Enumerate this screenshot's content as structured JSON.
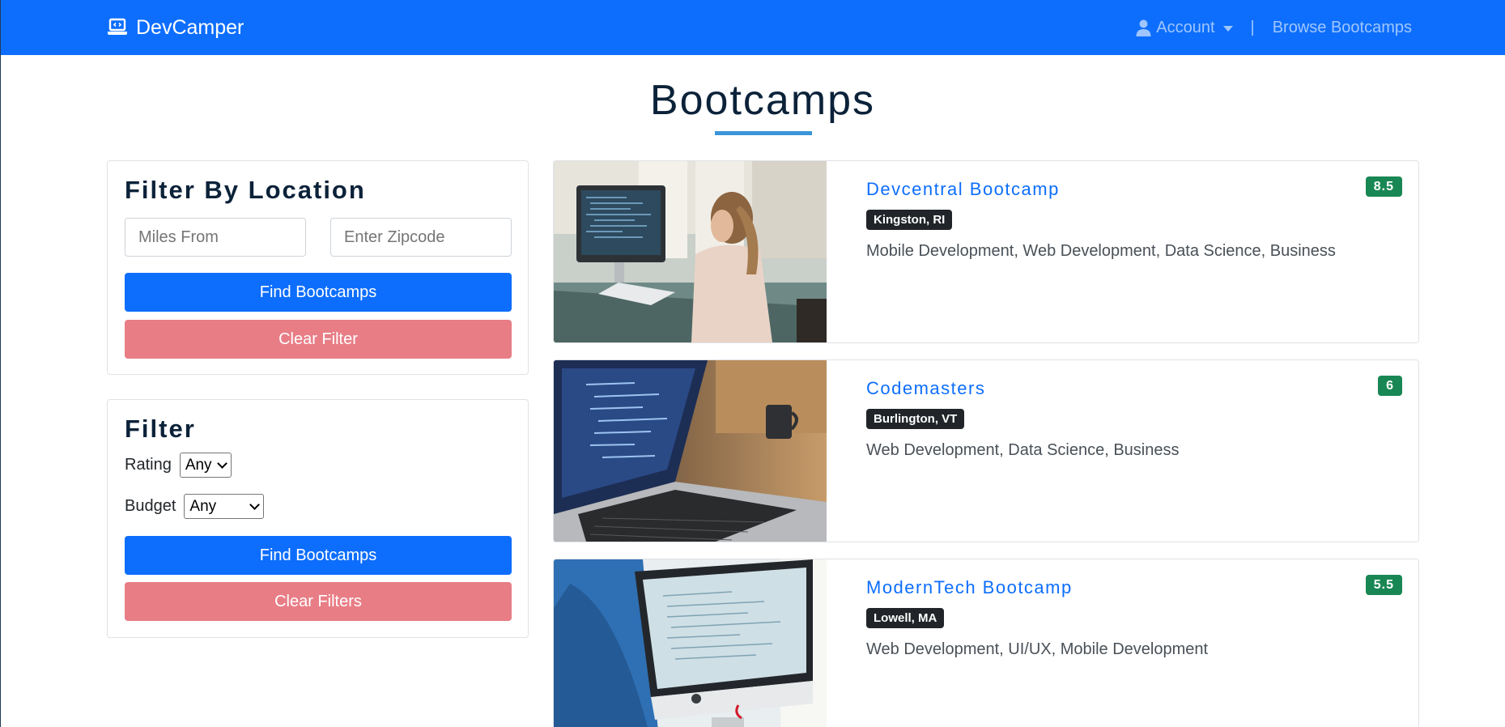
{
  "navbar": {
    "brand": "DevCamper",
    "account": "Account",
    "separator": "|",
    "browse": "Browse Bootcamps"
  },
  "page": {
    "title": "Bootcamps"
  },
  "location_filter": {
    "title": "Filter By Location",
    "miles_placeholder": "Miles From",
    "zipcode_placeholder": "Enter Zipcode",
    "find_button": "Find Bootcamps",
    "clear_button": "Clear Filter"
  },
  "filter": {
    "title": "Filter",
    "rating_label": "Rating",
    "rating_value": "Any",
    "budget_label": "Budget",
    "budget_value": "Any",
    "find_button": "Find Bootcamps",
    "clear_button": "Clear Filters"
  },
  "bootcamps": [
    {
      "name": "Devcentral Bootcamp",
      "location": "Kingston, RI",
      "careers": "Mobile Development, Web Development, Data Science, Business",
      "rating": "8.5"
    },
    {
      "name": "Codemasters",
      "location": "Burlington, VT",
      "careers": "Web Development, Data Science, Business",
      "rating": "6"
    },
    {
      "name": "ModernTech Bootcamp",
      "location": "Lowell, MA",
      "careers": "Web Development, UI/UX, Mobile Development",
      "rating": "5.5"
    }
  ],
  "colors": {
    "primary": "#0d6efd",
    "danger_light": "#e87d86",
    "rating_badge": "#198754",
    "location_badge": "#212529",
    "title_underline": "#3b95d9"
  }
}
